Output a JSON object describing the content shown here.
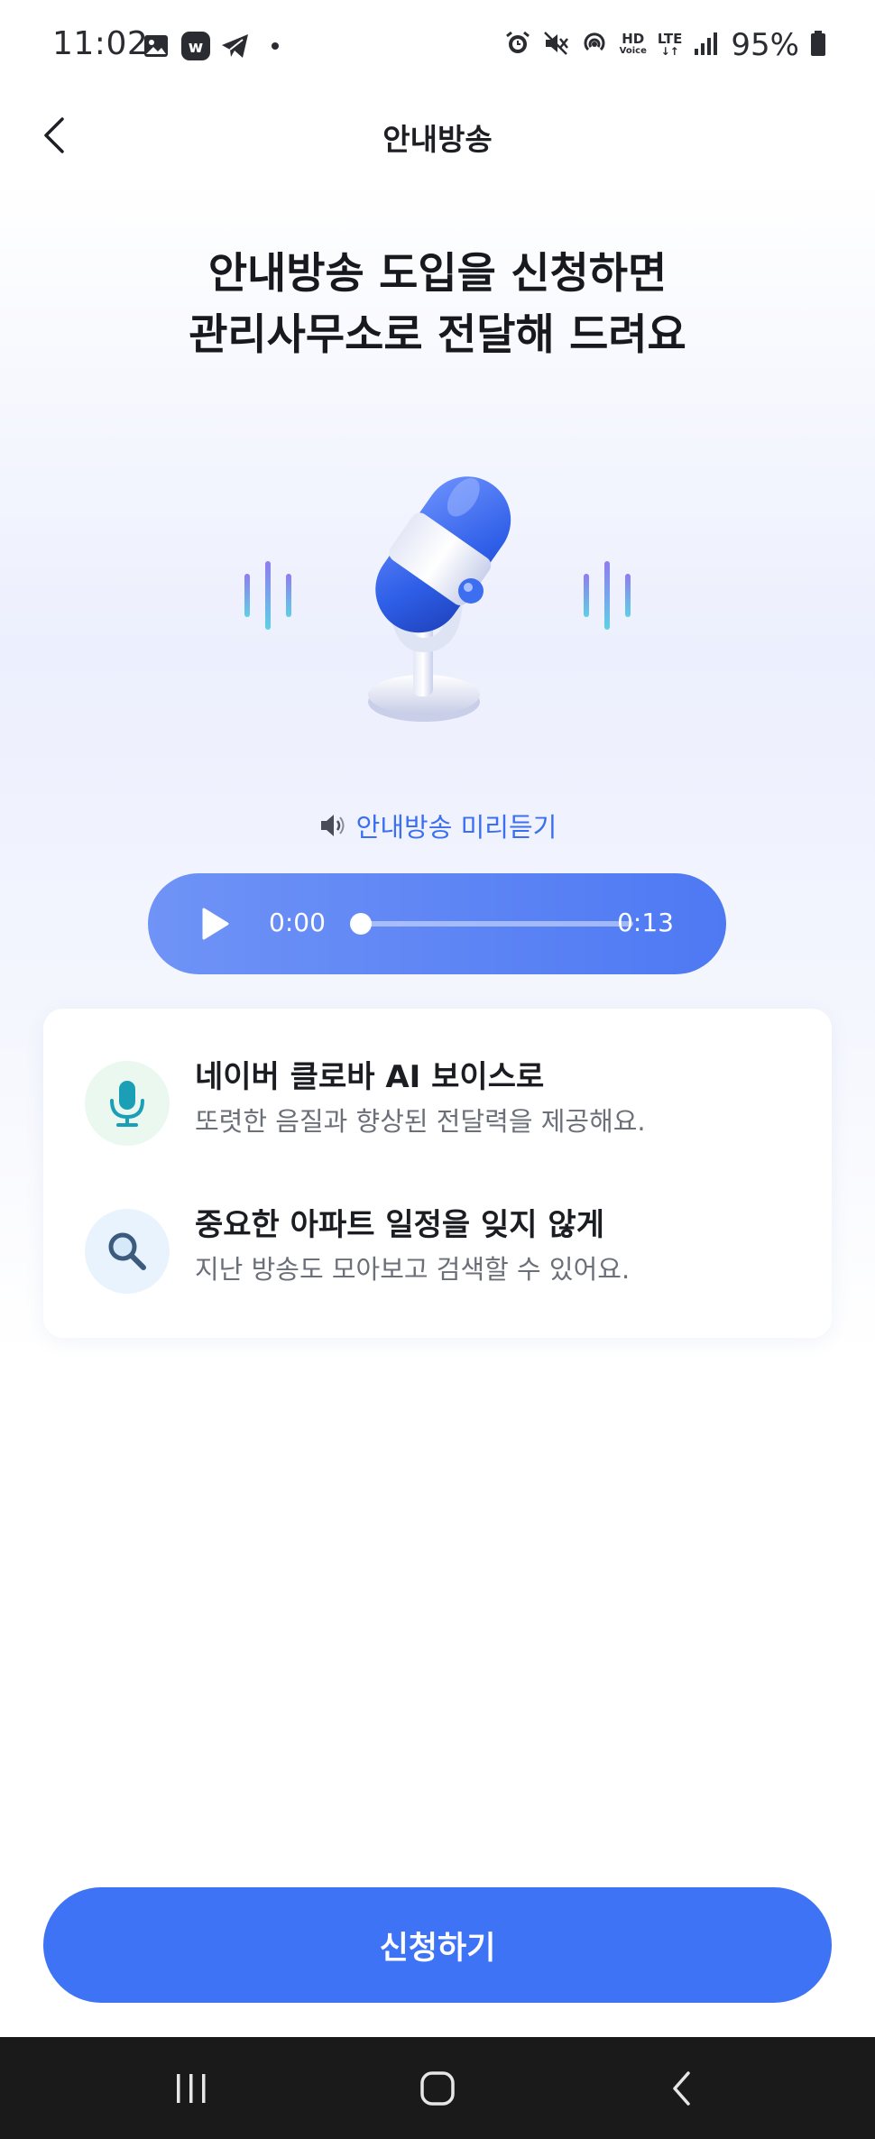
{
  "status_bar": {
    "time": "11:02",
    "battery": "95%",
    "hd_label": [
      "HD",
      "Voice"
    ],
    "lte_label": "LTE",
    "left_icons": [
      "gallery-icon",
      "w-app-icon",
      "telegram-icon",
      "dot-icon"
    ],
    "right_icons": [
      "alarm-icon",
      "mute-icon",
      "hotspot-icon",
      "hd-voice-icon",
      "lte-icon",
      "signal-icon",
      "battery-icon"
    ]
  },
  "header": {
    "title": "안내방송",
    "back_icon": "chevron-left-icon"
  },
  "headline": {
    "line1": "안내방송 도입을 신청하면",
    "line2": "관리사무소로 전달해 드려요"
  },
  "illustration": {
    "name": "microphone-illustration"
  },
  "preview": {
    "label": "안내방송 미리듣기",
    "icon": "speaker-icon"
  },
  "player": {
    "current_time": "0:00",
    "total_time": "0:13",
    "progress": 0
  },
  "features": [
    {
      "title": "네이버 클로바 AI 보이스로",
      "description": "또렷한 음질과 향상된 전달력을 제공해요.",
      "icon": "microphone-icon",
      "icon_bg": "#eaf8ef",
      "icon_color": "#1a9fb6"
    },
    {
      "title": "중요한 아파트 일정을 잊지 않게",
      "description": "지난 방송도 모아보고 검색할 수 있어요.",
      "icon": "search-icon",
      "icon_bg": "#e9f3fd",
      "icon_color": "#3c5a7e"
    }
  ],
  "cta": {
    "label": "신청하기"
  },
  "nav": {
    "items": [
      "recent-apps-icon",
      "home-icon",
      "back-icon"
    ]
  },
  "colors": {
    "accent": "#3f73f5",
    "player_start": "#6f93f6",
    "player_end": "#4e79f3",
    "link": "#3a6ff1"
  }
}
